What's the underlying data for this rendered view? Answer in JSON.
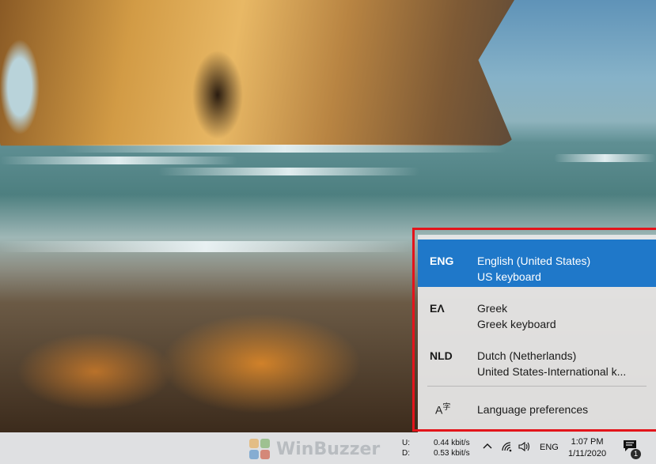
{
  "languages": [
    {
      "code": "ENG",
      "name": "English (United States)",
      "keyboard": "US keyboard",
      "selected": true
    },
    {
      "code": "ΕΛ",
      "name": "Greek",
      "keyboard": "Greek keyboard",
      "selected": false
    },
    {
      "code": "NLD",
      "name": "Dutch (Netherlands)",
      "keyboard": "United States-International k...",
      "selected": false
    }
  ],
  "preferences": {
    "icon_glyph": "A",
    "icon_sup": "字",
    "label": "Language preferences"
  },
  "watermark": {
    "text": "WinBuzzer"
  },
  "netspeed": {
    "upload_label": "U:",
    "download_label": "D:",
    "upload": "0.44 kbit/s",
    "download": "0.53 kbit/s"
  },
  "tray": {
    "language": "ENG",
    "time": "1:07 PM",
    "date": "1/11/2020",
    "notifications_count": "1"
  },
  "colors": {
    "selected": "#1f78c9",
    "highlight_border": "#e3141b",
    "taskbar": "#dfe0e2"
  }
}
